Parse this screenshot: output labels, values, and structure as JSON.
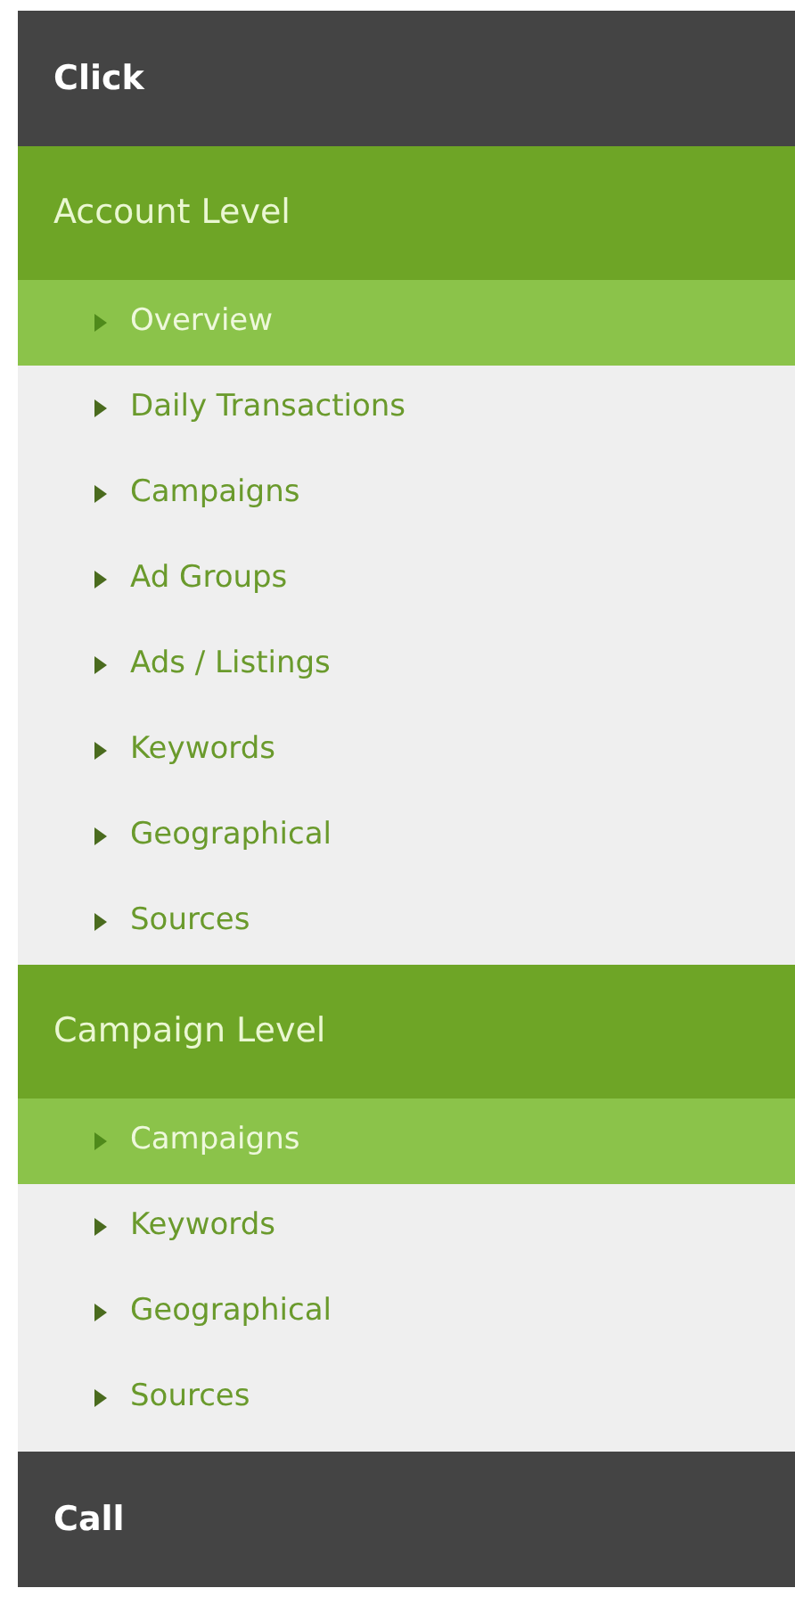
{
  "sections": [
    {
      "label": "Click",
      "groups": [
        {
          "label": "Account Level",
          "items": [
            {
              "label": "Overview",
              "selected": true
            },
            {
              "label": "Daily Transactions",
              "selected": false
            },
            {
              "label": "Campaigns",
              "selected": false
            },
            {
              "label": "Ad Groups",
              "selected": false
            },
            {
              "label": "Ads / Listings",
              "selected": false
            },
            {
              "label": "Keywords",
              "selected": false
            },
            {
              "label": "Geographical",
              "selected": false
            },
            {
              "label": "Sources",
              "selected": false
            }
          ]
        },
        {
          "label": "Campaign Level",
          "items": [
            {
              "label": "Campaigns",
              "selected": true
            },
            {
              "label": "Keywords",
              "selected": false
            },
            {
              "label": "Geographical",
              "selected": false
            },
            {
              "label": "Sources",
              "selected": false
            }
          ]
        }
      ]
    },
    {
      "label": "Call"
    }
  ]
}
